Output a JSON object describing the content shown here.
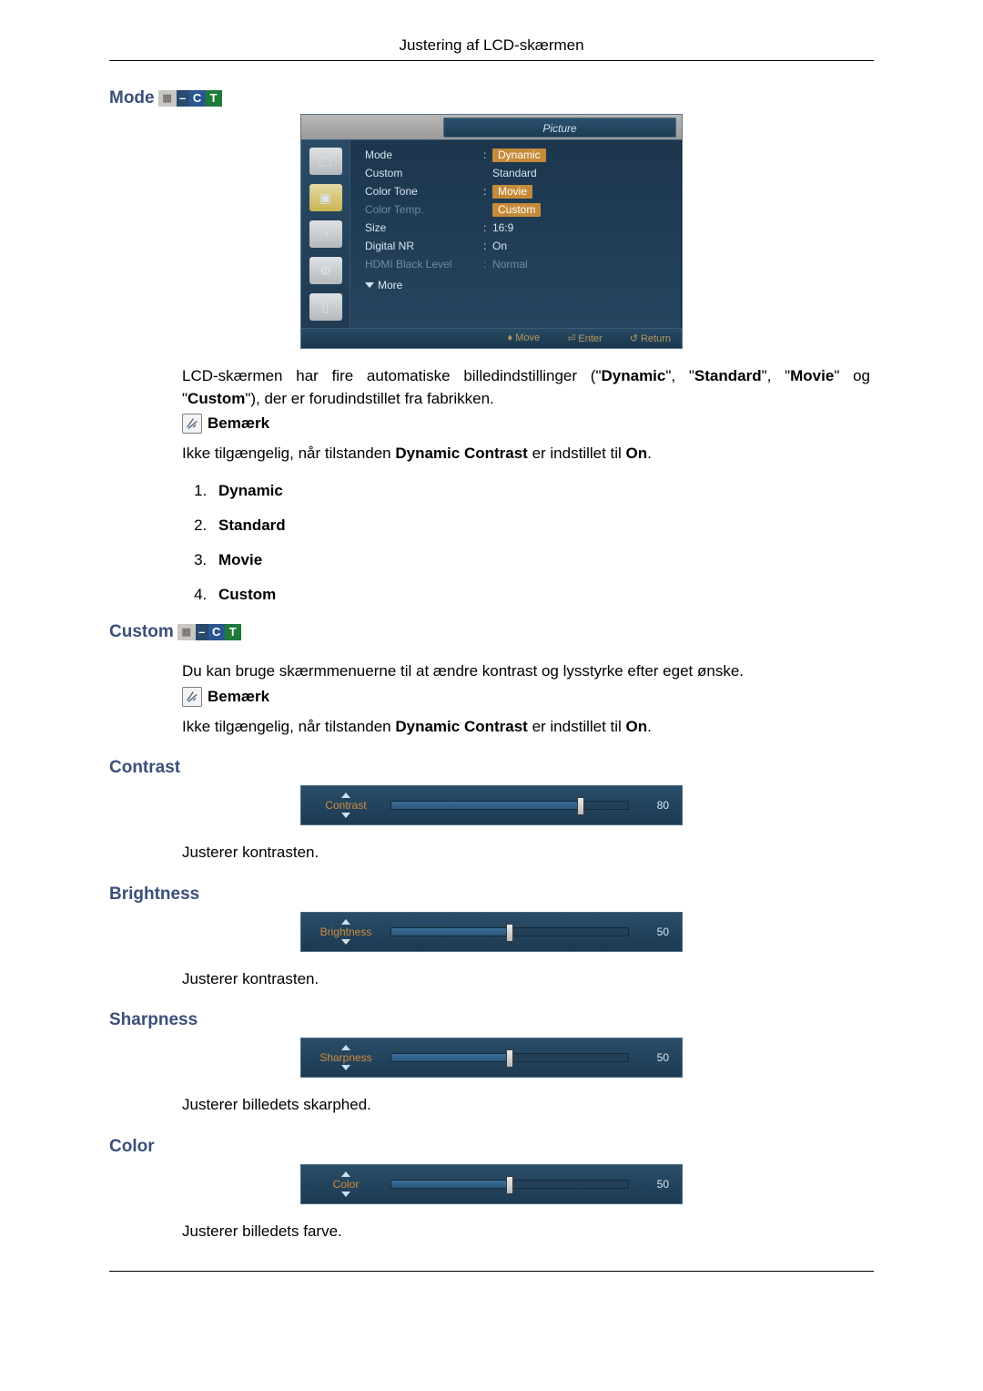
{
  "header": "Justering af LCD-skærmen",
  "sections": {
    "mode": {
      "title": "Mode",
      "osd": {
        "title": "Picture",
        "items": [
          {
            "label": "Mode",
            "value": "Dynamic",
            "hl": true,
            "dim": false
          },
          {
            "label": "Custom",
            "value": "Standard",
            "hl": false,
            "dim": false
          },
          {
            "label": "Color Tone",
            "value": "Movie",
            "hl": true,
            "dim": false
          },
          {
            "label": "Color Temp.",
            "value": "Custom",
            "hl": true,
            "dim": true
          },
          {
            "label": "Size",
            "value": "16:9",
            "hl": false,
            "dim": false
          },
          {
            "label": "Digital NR",
            "value": "On",
            "hl": false,
            "dim": false
          },
          {
            "label": "HDMI Black Level",
            "value": "Normal",
            "hl": false,
            "dim": true
          }
        ],
        "more": "More",
        "footer": [
          "Move",
          "Enter",
          "Return"
        ]
      },
      "para": "LCD-skærmen har fire automatiske billedindstillinger (\"Dynamic\", \"Standard\", \"Movie\" og \"Custom\"), der er forudindstillet fra fabrikken.",
      "note_label": "Bemærk",
      "note_text": "Ikke tilgængelig, når tilstanden Dynamic Contrast er indstillet til On.",
      "list": [
        "Dynamic",
        "Standard",
        "Movie",
        "Custom"
      ]
    },
    "custom": {
      "title": "Custom",
      "para": "Du kan bruge skærmmenuerne til at ændre kontrast og lysstyrke efter eget ønske.",
      "note_label": "Bemærk",
      "note_text": "Ikke tilgængelig, når tilstanden Dynamic Contrast er indstillet til On."
    },
    "contrast": {
      "title": "Contrast",
      "slider": {
        "label": "Contrast",
        "value": 80
      },
      "desc": "Justerer kontrasten."
    },
    "brightness": {
      "title": "Brightness",
      "slider": {
        "label": "Brightness",
        "value": 50
      },
      "desc": "Justerer kontrasten."
    },
    "sharpness": {
      "title": "Sharpness",
      "slider": {
        "label": "Sharpness",
        "value": 50
      },
      "desc": "Justerer billedets skarphed."
    },
    "color": {
      "title": "Color",
      "slider": {
        "label": "Color",
        "value": 50
      },
      "desc": "Justerer billedets farve."
    }
  }
}
